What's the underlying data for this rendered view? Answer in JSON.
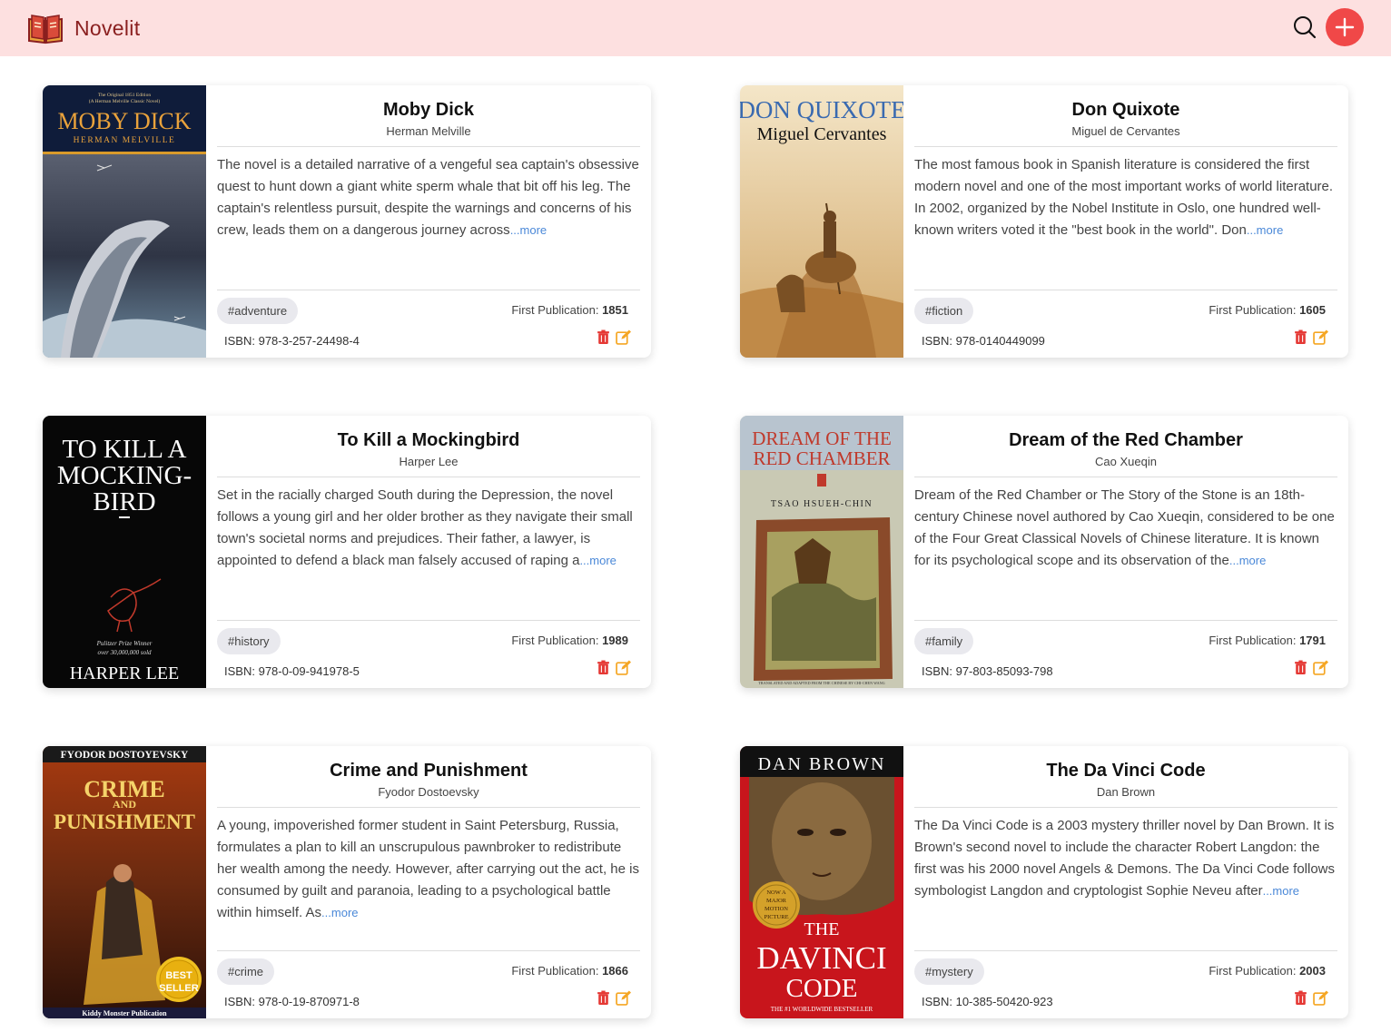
{
  "app": {
    "name": "Novelit",
    "brand_color": "#8a1f1f",
    "navbar_color": "#fde0e0",
    "add_button_color": "#f04848",
    "link_color": "#4a88d8"
  },
  "labels": {
    "first_publication": "First Publication:",
    "isbn": "ISBN:",
    "more": "...more"
  },
  "books": [
    {
      "title": "Moby Dick",
      "author": "Herman Melville",
      "description": "The novel is a detailed narrative of a vengeful sea captain's obsessive quest to hunt down a giant white sperm whale that bit off his leg. The captain's relentless pursuit, despite the warnings and concerns of his crew, leads them on a dangerous journey across",
      "tag": "#adventure",
      "year": "1851",
      "isbn": "978-3-257-24498-4",
      "cover": {
        "top": "The Original 1851 Edition",
        "top2": "(A Herman Melville Classic Novel)",
        "title": "MOBY DICK",
        "author": "HERMAN MELVILLE"
      }
    },
    {
      "title": "Don Quixote",
      "author": "Miguel de Cervantes",
      "description": "The most famous book in Spanish literature is considered the first modern novel and one of the most important works of world literature. In 2002, organized by the Nobel Institute in Oslo, one hundred well-known writers voted it the \"best book in the world\". Don",
      "tag": "#fiction",
      "year": "1605",
      "isbn": "978-0140449099",
      "cover": {
        "title": "DON QUIXOTE",
        "author": "Miguel Cervantes"
      }
    },
    {
      "title": "To Kill a Mockingbird",
      "author": "Harper Lee",
      "description": "Set in the racially charged South during the Depression, the novel follows a young girl and her older brother as they navigate their small town's societal norms and prejudices. Their father, a lawyer, is appointed to defend a black man falsely accused of raping a",
      "tag": "#history",
      "year": "1989",
      "isbn": "978-0-09-941978-5",
      "cover": {
        "line1": "TO KILL A",
        "line2": "MOCKING-",
        "line3": "BIRD",
        "award": "Pulitzer Prize Winner",
        "sold": "over 30,000,000 sold",
        "author": "HARPER LEE"
      }
    },
    {
      "title": "Dream of the Red Chamber",
      "author": "Cao Xueqin",
      "description": "Dream of the Red Chamber or The Story of the Stone is an 18th-century Chinese novel authored by Cao Xueqin, considered to be one of the Four Great Classical Novels of Chinese literature. It is known for its psychological scope and its observation of the",
      "tag": "#family",
      "year": "1791",
      "isbn": "97-803-85093-798",
      "cover": {
        "line1": "DREAM OF THE",
        "line2": "RED CHAMBER",
        "author": "TSAO HSUEH-CHIN",
        "bottom": "TRANSLATED AND ADAPTED FROM THE CHINESE BY CHI-CHEN WANG"
      }
    },
    {
      "title": "Crime and Punishment",
      "author": "Fyodor Dostoevsky",
      "description": "A young, impoverished former student in Saint Petersburg, Russia, formulates a plan to kill an unscrupulous pawnbroker to redistribute her wealth among the needy. However, after carrying out the act, he is consumed by guilt and paranoia, leading to a psychological battle within himself. As",
      "tag": "#crime",
      "year": "1866",
      "isbn": "978-0-19-870971-8",
      "cover": {
        "author": "FYODOR DOSTOYEVSKY",
        "line1": "CRIME",
        "line2": "AND",
        "line3": "PUNISHMENT",
        "badge1": "BEST",
        "badge2": "SELLER",
        "publisher": "Kiddy Monster Publication"
      }
    },
    {
      "title": "The Da Vinci Code",
      "author": "Dan Brown",
      "description": "The Da Vinci Code is a 2003 mystery thriller novel by Dan Brown. It is Brown's second novel to include the character Robert Langdon: the first was his 2000 novel Angels & Demons. The Da Vinci Code follows symbologist Langdon and cryptologist Sophie Neveu after",
      "tag": "#mystery",
      "year": "2003",
      "isbn": "10-385-50420-923",
      "cover": {
        "author": "DAN BROWN",
        "line1": "THE",
        "line2": "DAVINCI",
        "line3": "CODE",
        "badge1": "NOW A",
        "badge2": "MAJOR",
        "badge3": "MOTION",
        "badge4": "PICTURE",
        "bottom": "THE #1 WORLDWIDE BESTSELLER"
      }
    }
  ]
}
